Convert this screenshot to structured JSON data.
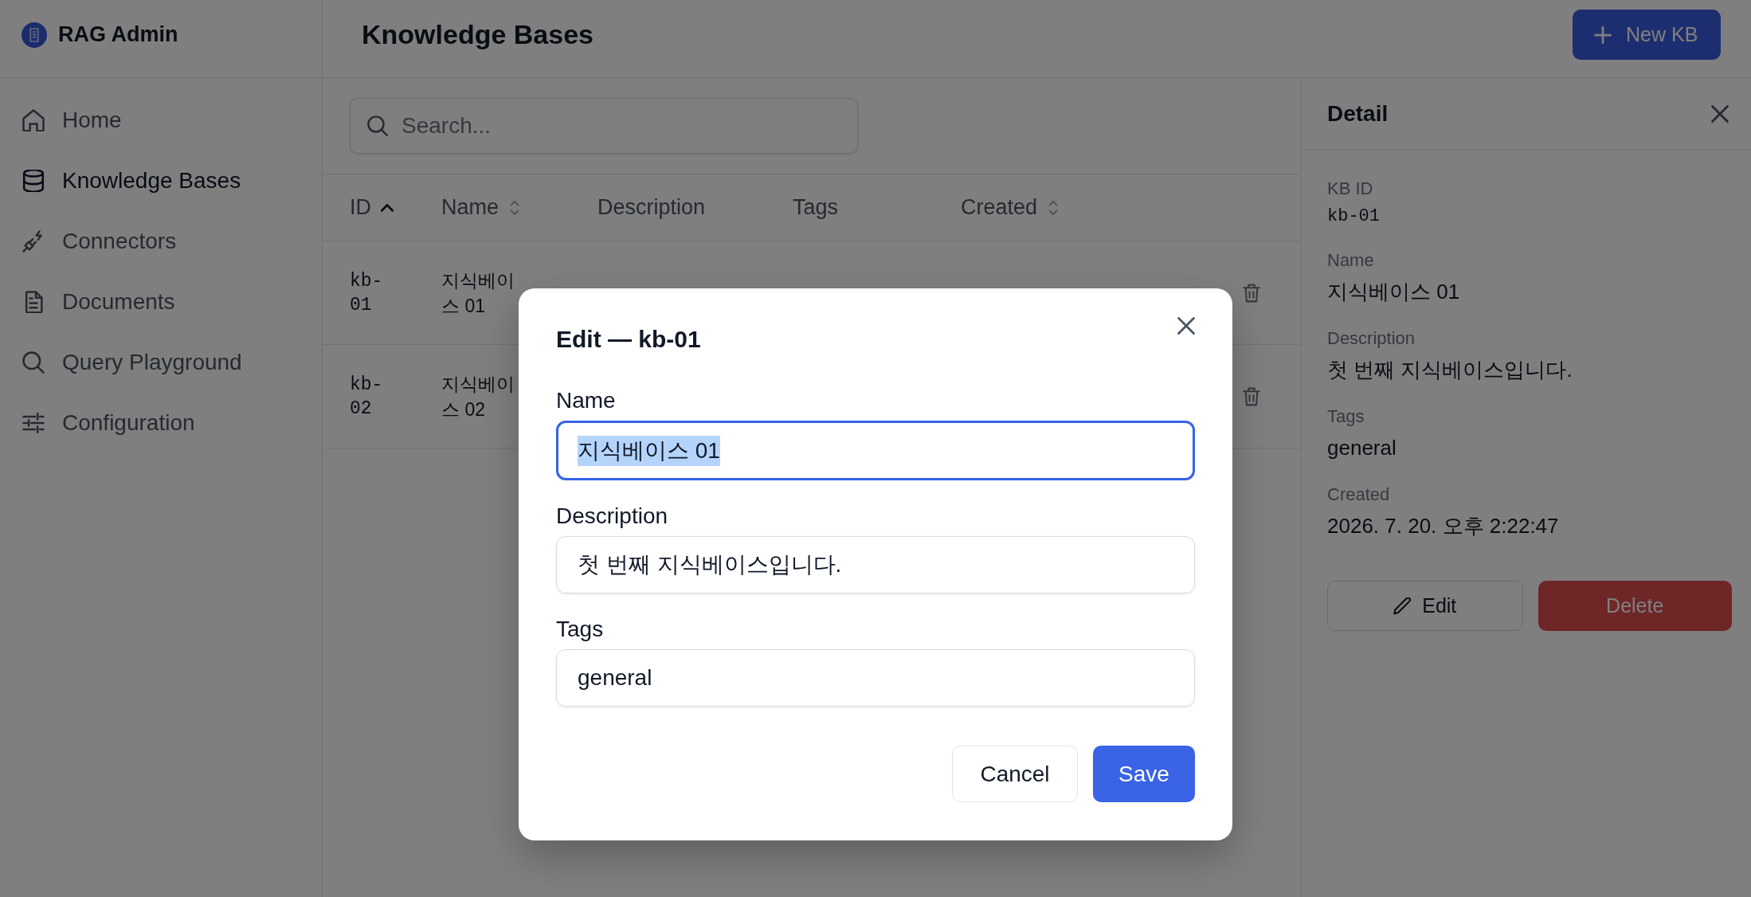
{
  "sidebar": {
    "brand": "RAG Admin",
    "items": [
      {
        "label": "Home",
        "selected": false
      },
      {
        "label": "Knowledge Bases",
        "selected": true
      },
      {
        "label": "Connectors",
        "selected": false
      },
      {
        "label": "Documents",
        "selected": false
      },
      {
        "label": "Query Playground",
        "selected": false
      },
      {
        "label": "Configuration",
        "selected": false
      }
    ]
  },
  "header": {
    "title": "Knowledge Bases",
    "primary_button": "New KB"
  },
  "search": {
    "placeholder": "Search..."
  },
  "table": {
    "columns": [
      {
        "label": "ID",
        "sortable": true,
        "sorted": true
      },
      {
        "label": "Name",
        "sortable": true,
        "sorted": false
      },
      {
        "label": "Description",
        "sortable": false,
        "sorted": false
      },
      {
        "label": "Tags",
        "sortable": false,
        "sorted": false
      },
      {
        "label": "Created",
        "sortable": true,
        "sorted": false
      }
    ],
    "rows": [
      {
        "id": "kb-01",
        "name": "지식베이스 01"
      },
      {
        "id": "kb-02",
        "name": "지식베이스 02"
      }
    ]
  },
  "detail": {
    "title": "Detail",
    "fields": [
      {
        "label": "KB ID",
        "value": "kb-01",
        "kind": "mono"
      },
      {
        "label": "Name",
        "value": "지식베이스 01",
        "kind": "text"
      },
      {
        "label": "Description",
        "value": "첫 번째 지식베이스입니다.",
        "kind": "text"
      },
      {
        "label": "Tags",
        "value": "general",
        "kind": "text"
      },
      {
        "label": "Created",
        "value": "2026. 7. 20. 오후 2:22:47",
        "kind": "text"
      }
    ],
    "buttons": [
      {
        "label": "Edit",
        "kind": "edit"
      },
      {
        "label": "Delete",
        "kind": "delete"
      }
    ]
  },
  "modal": {
    "title": "Edit — kb-01",
    "fields": [
      {
        "label": "Name",
        "value": "지식베이스 01",
        "focused": true,
        "highlighted": true
      },
      {
        "label": "Description",
        "value": "첫 번째 지식베이스입니다.",
        "focused": false,
        "highlighted": false
      },
      {
        "label": "Tags",
        "value": "general",
        "focused": false,
        "highlighted": false
      }
    ],
    "buttons": [
      {
        "label": "Cancel",
        "kind": "cancel"
      },
      {
        "label": "Save",
        "kind": "save"
      }
    ]
  }
}
